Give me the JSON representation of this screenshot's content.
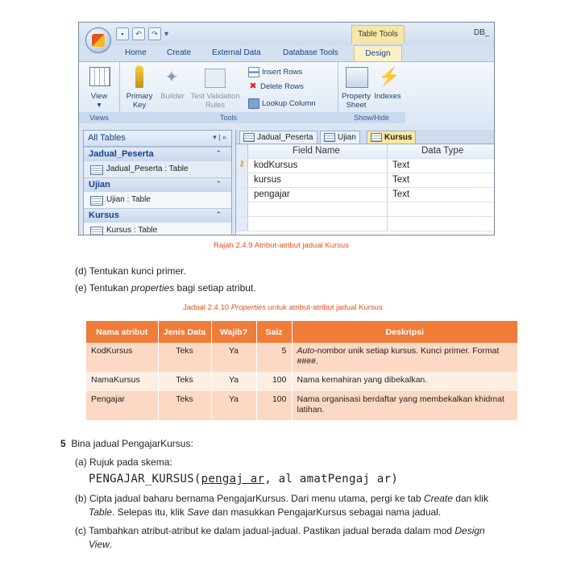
{
  "access": {
    "window_title": "DB_",
    "table_tools": "Table Tools",
    "tabs": [
      "Home",
      "Create",
      "External Data",
      "Database Tools",
      "Design"
    ],
    "ribbon": {
      "view": "View",
      "primary_key": [
        "Primary",
        "Key"
      ],
      "builder": "Builder",
      "test_validation": [
        "Test Validation",
        "Rules"
      ],
      "insert_rows": "Insert Rows",
      "delete_rows": "Delete Rows",
      "lookup_column": "Lookup Column",
      "property_sheet": [
        "Property",
        "Sheet"
      ],
      "indexes": "Indexes",
      "group_views": "Views",
      "group_tools": "Tools",
      "group_showhide": "Show/Hide"
    },
    "nav": {
      "header": "All Tables",
      "groups": [
        {
          "name": "Jadual_Peserta",
          "item": "Jadual_Peserta : Table"
        },
        {
          "name": "Ujian",
          "item": "Ujian : Table"
        },
        {
          "name": "Kursus",
          "item": "Kursus : Table"
        }
      ]
    },
    "doc_tabs": [
      "Jadual_Peserta",
      "Ujian",
      "Kursus"
    ],
    "grid": {
      "headers": [
        "Field Name",
        "Data Type"
      ],
      "rows": [
        {
          "field": "kodKursus",
          "type": "Text"
        },
        {
          "field": "kursus",
          "type": "Text"
        },
        {
          "field": "pengajar",
          "type": "Text"
        }
      ]
    }
  },
  "figure_caption": "Rajah 2.4.9  Atribut-atribut jadual Kursus",
  "steps_d_e": {
    "d": "(d)  Tentukan kunci primer.",
    "e_prefix": "(e)  Tentukan ",
    "e_italic": "properties",
    "e_suffix": " bagi setiap atribut."
  },
  "table_caption": {
    "prefix": "Jadual 2.4.10  ",
    "italic": "Properties",
    "suffix": " untuk atribut-atribut jadual Kursus"
  },
  "properties_table": {
    "headers": [
      "Nama atribut",
      "Jenis Data",
      "Wajib?",
      "Saiz",
      "Deskripsi"
    ],
    "rows": [
      {
        "name": "KodKursus",
        "type": "Teks",
        "req": "Ya",
        "size": "5",
        "desc_italic": "Auto",
        "desc": "-nombor unik setiap kursus. Kunci primer. Format ####."
      },
      {
        "name": "NamaKursus",
        "type": "Teks",
        "req": "Ya",
        "size": "100",
        "desc_italic": "",
        "desc": "Nama kemahiran yang dibekalkan."
      },
      {
        "name": "Pengajar",
        "type": "Teks",
        "req": "Ya",
        "size": "100",
        "desc_italic": "",
        "desc": "Nama organisasi berdaftar yang membekalkan khidmat latihan."
      }
    ]
  },
  "step5": {
    "number": "5",
    "title": "Bina jadual PengajarKursus:",
    "a": "(a)  Rujuk pada skema:",
    "schema_name": "PENGAJAR_KURSUS(",
    "schema_key": "pengaj ar",
    "schema_rest": ",  al amatPengaj ar)",
    "b_1": "(b)  Cipta jadual baharu bernama PengajarKursus. Dari menu utama, pergi ke tab ",
    "b_create": "Create",
    "b_2": " dan klik",
    "b_table": "Table",
    "b_3": ". Selepas itu, klik ",
    "b_save": "Save",
    "b_4": " dan masukkan PengajarKursus sebagai nama jadual.",
    "c_1": "(c)  Tambahkan atribut-atribut ke dalam jadual-jadual. Pastikan jadual berada dalam mod ",
    "c_design": "Design",
    "c_view": "View",
    "c_end": "."
  },
  "colors": {
    "accent": "#f07c3a",
    "caption": "#e8501a",
    "row_dark": "#fbd9c4",
    "row_light": "#fdeee3"
  }
}
